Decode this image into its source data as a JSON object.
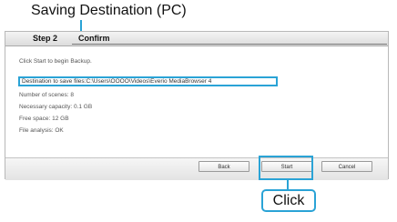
{
  "callout": {
    "title": "Saving Destination (PC)",
    "click_label": "Click"
  },
  "wizard": {
    "tabs": [
      {
        "label": "Step 2"
      },
      {
        "label": "Confirm"
      }
    ],
    "lines": [
      "Click Start to begin Backup.",
      "Number of scenes: 8",
      "Necessary capacity: 0.1 GB",
      "Free space: 12 GB",
      "File analysis: OK"
    ],
    "destination": "Destination to save files:C:\\Users\\OOOO\\Videos\\Everio MediaBrowser 4"
  },
  "buttons": {
    "back": "Back",
    "start": "Start",
    "cancel": "Cancel"
  },
  "colors": {
    "highlight": "#2aa3d6"
  }
}
